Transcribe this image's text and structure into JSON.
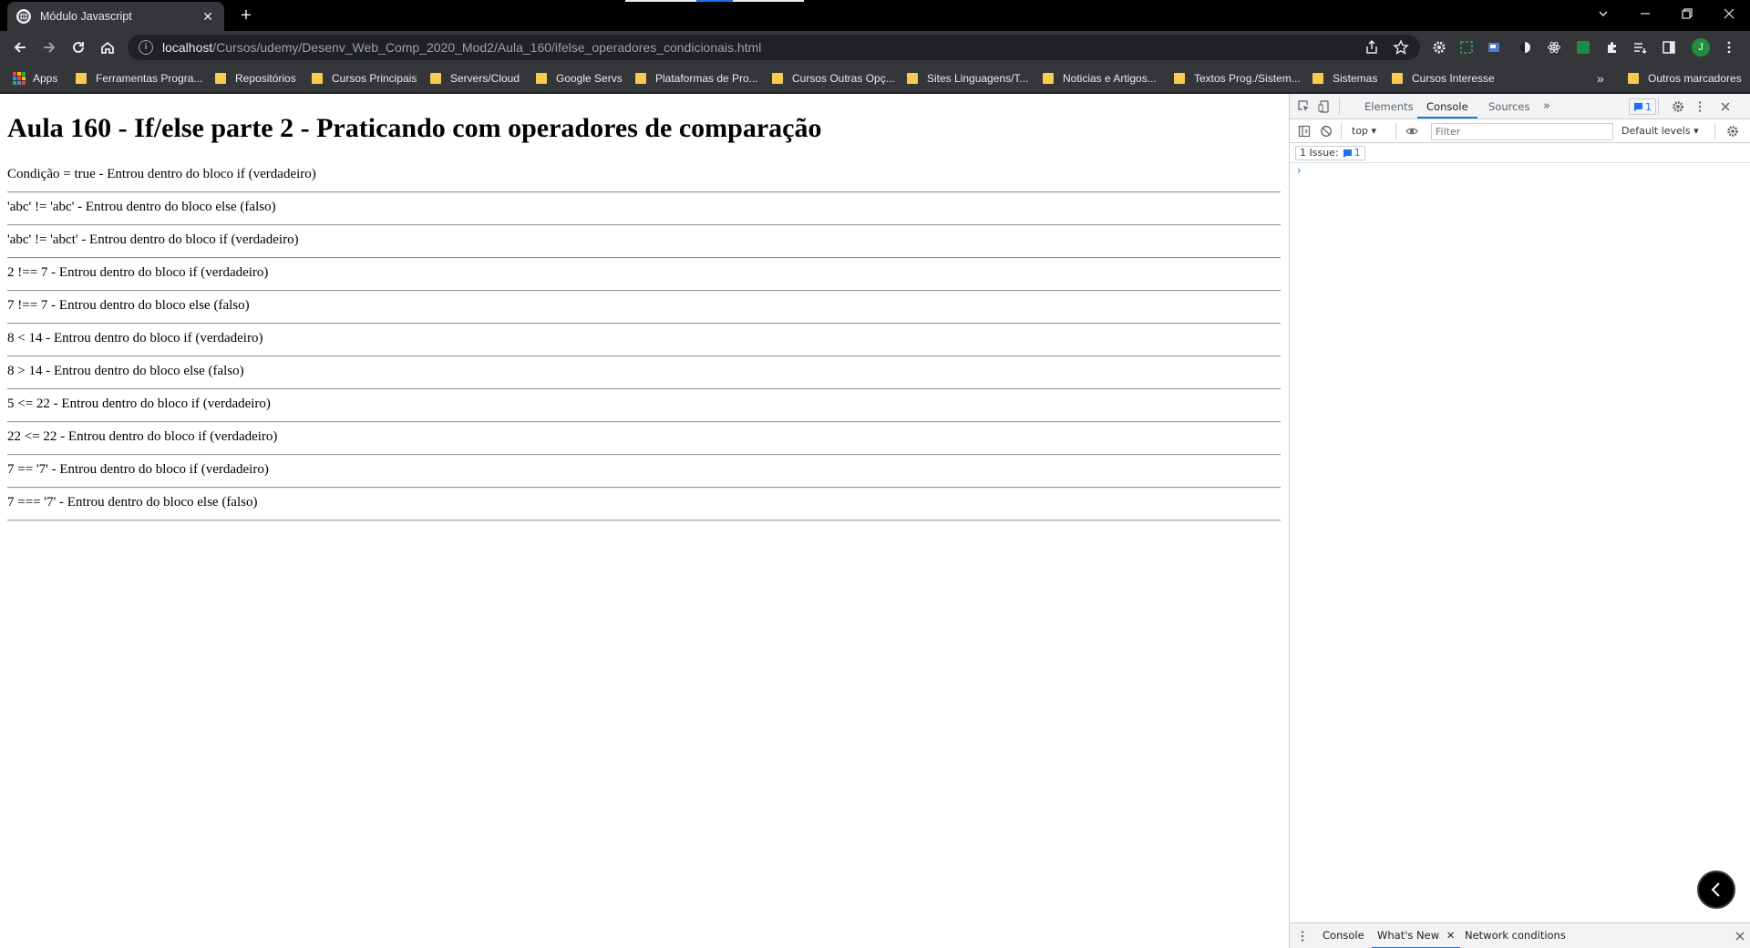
{
  "browser": {
    "tab": {
      "title": "Módulo Javascript",
      "close_glyph": "✕"
    },
    "new_tab_glyph": "+",
    "address": {
      "host": "localhost",
      "path": "/Cursos/udemy/Desenv_Web_Comp_2020_Mod2/Aula_160/ifelse_operadores_condicionais.html"
    },
    "profile_initial": "J",
    "bookmarks": [
      {
        "label": "Apps",
        "kind": "apps"
      },
      {
        "label": "Ferramentas Progra...",
        "kind": "folder"
      },
      {
        "label": "Repositórios",
        "kind": "folder"
      },
      {
        "label": "Cursos Principais",
        "kind": "folder"
      },
      {
        "label": "Servers/Cloud",
        "kind": "folder"
      },
      {
        "label": "Google Servs",
        "kind": "folder"
      },
      {
        "label": "Plataformas de Pro...",
        "kind": "folder"
      },
      {
        "label": "Cursos Outras Opç...",
        "kind": "folder"
      },
      {
        "label": "Sites Linguagens/T...",
        "kind": "folder"
      },
      {
        "label": "Noticias e Artigos...",
        "kind": "folder"
      },
      {
        "label": "Textos Prog./Sistem...",
        "kind": "folder"
      },
      {
        "label": "Sistemas",
        "kind": "folder"
      },
      {
        "label": "Cursos Interesse",
        "kind": "folder"
      }
    ],
    "bookmarks_overflow": "»",
    "other_bookmarks": "Outros marcadores"
  },
  "page": {
    "heading": "Aula 160 - If/else parte 2 - Praticando com operadores de comparação",
    "results": [
      "Condição = true - Entrou dentro do bloco if (verdadeiro)",
      "'abc' != 'abc' - Entrou dentro do bloco else (falso)",
      "'abc' != 'abct' - Entrou dentro do bloco if (verdadeiro)",
      "2 !== 7 - Entrou dentro do bloco if (verdadeiro)",
      "7 !== 7 - Entrou dentro do bloco else (falso)",
      "8 < 14 - Entrou dentro do bloco if (verdadeiro)",
      "8 > 14 - Entrou dentro do bloco else (falso)",
      "5 <= 22 - Entrou dentro do bloco if (verdadeiro)",
      "22 <= 22 - Entrou dentro do bloco if (verdadeiro)",
      "7 == '7' - Entrou dentro do bloco if (verdadeiro)",
      "7 === '7' - Entrou dentro do bloco else (falso)"
    ]
  },
  "devtools": {
    "tabs": [
      "Elements",
      "Console",
      "Sources"
    ],
    "active_tab": "Console",
    "more_tabs_glyph": "»",
    "issues_badge_count": "1",
    "context": "top",
    "filter_placeholder": "Filter",
    "levels": "Default levels",
    "issues_label": "1 Issue:",
    "issues_count": "1",
    "prompt_glyph": "›",
    "drawer_tabs": [
      "Console",
      "What's New",
      "Network conditions"
    ],
    "drawer_active": "What's New",
    "drawer_close_glyph": "✕"
  },
  "colors": {
    "accent": "#1a73e8",
    "folder": "#f7cb4d",
    "profile": "#1e8e3e",
    "chrome_dark": "#35363a"
  }
}
